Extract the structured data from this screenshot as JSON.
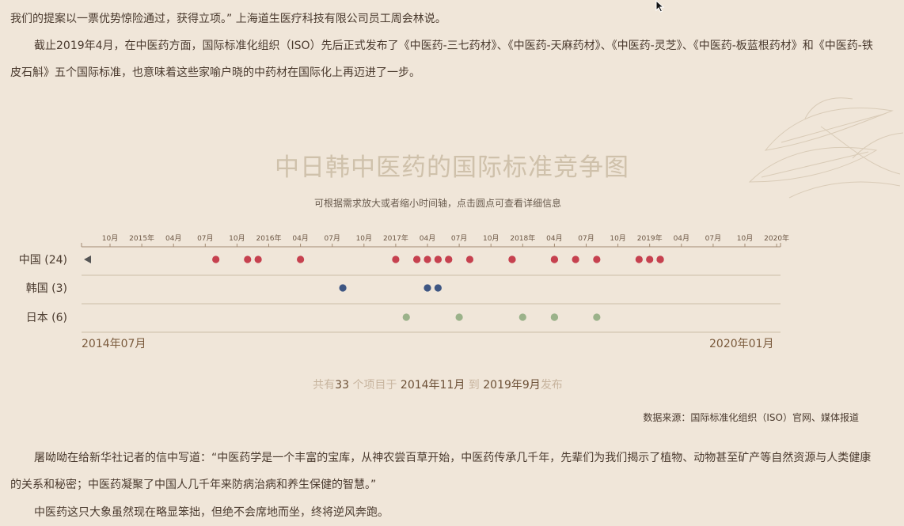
{
  "paragraphs": {
    "p1": "我们的提案以一票优势惊险通过，获得立项。” 上海道生医疗科技有限公司员工周会林说。",
    "p2": "截止2019年4月，在中医药方面，国际标准化组织（ISO）先后正式发布了《中医药-三七药材》、《中医药-天麻药材》、《中医药-灵芝》、《中医药-板蓝根药材》和《中医药-铁皮石斛》五个国际标准，也意味着这些家喻户晓的中药材在国际化上再迈进了一步。",
    "p3": "屠呦呦在给新华社记者的信中写道：“中医药学是一个丰富的宝库，从神农尝百草开始，中医药传承几千年，先辈们为我们揭示了植物、动物甚至矿产等自然资源与人类健康的关系和秘密；中医药凝聚了中国人几千年来防病治病和养生保健的智慧。”",
    "p4": "中医药这只大象虽然现在略显笨拙，但绝不会席地而坐，终将逆风奔跑。"
  },
  "chart_data": {
    "type": "scatter",
    "title": "中日韩中医药的国际标准竞争图",
    "subtitle": "可根据需求放大或者缩小时间轴，点击圆点可查看详细信息",
    "x_axis": {
      "tick_labels": [
        "10月",
        "2015年",
        "04月",
        "07月",
        "10月",
        "2016年",
        "04月",
        "07月",
        "10月",
        "2017年",
        "04月",
        "07月",
        "10月",
        "2018年",
        "04月",
        "07月",
        "10月",
        "2019年",
        "04月",
        "07月",
        "10月",
        "2020年"
      ],
      "range_start": "2014年07月",
      "range_end": "2020年01月"
    },
    "series": [
      {
        "name": "中国",
        "count_label": "中国 (24)",
        "color": "#c6414f",
        "x": [
          "2015-08",
          "2015-11",
          "2015-12",
          "2016-04",
          "2017-01",
          "2017-03",
          "2017-03",
          "2017-04",
          "2017-05",
          "2017-05",
          "2017-06",
          "2017-06",
          "2017-08",
          "2017-12",
          "2017-12",
          "2018-04",
          "2018-04",
          "2018-06",
          "2018-08",
          "2018-12",
          "2019-01",
          "2019-02",
          "2019-02",
          "2019-02"
        ]
      },
      {
        "name": "韩国",
        "count_label": "韩国 (3)",
        "color": "#3e5683",
        "x": [
          "2016-08",
          "2017-04",
          "2017-05"
        ]
      },
      {
        "name": "日本",
        "count_label": "日本 (6)",
        "color": "#9bb28a",
        "x": [
          "2017-02",
          "2017-07",
          "2018-01",
          "2018-04",
          "2018-04",
          "2018-08"
        ]
      }
    ],
    "summary": {
      "prefix": "共有",
      "count": "33",
      "mid1": " 个项目于 ",
      "start": "2014年11月",
      "mid2": " 到 ",
      "end": "2019年9月",
      "suffix": "发布"
    },
    "source": "数据来源：国际标准化组织（ISO）官网、媒体报道"
  }
}
